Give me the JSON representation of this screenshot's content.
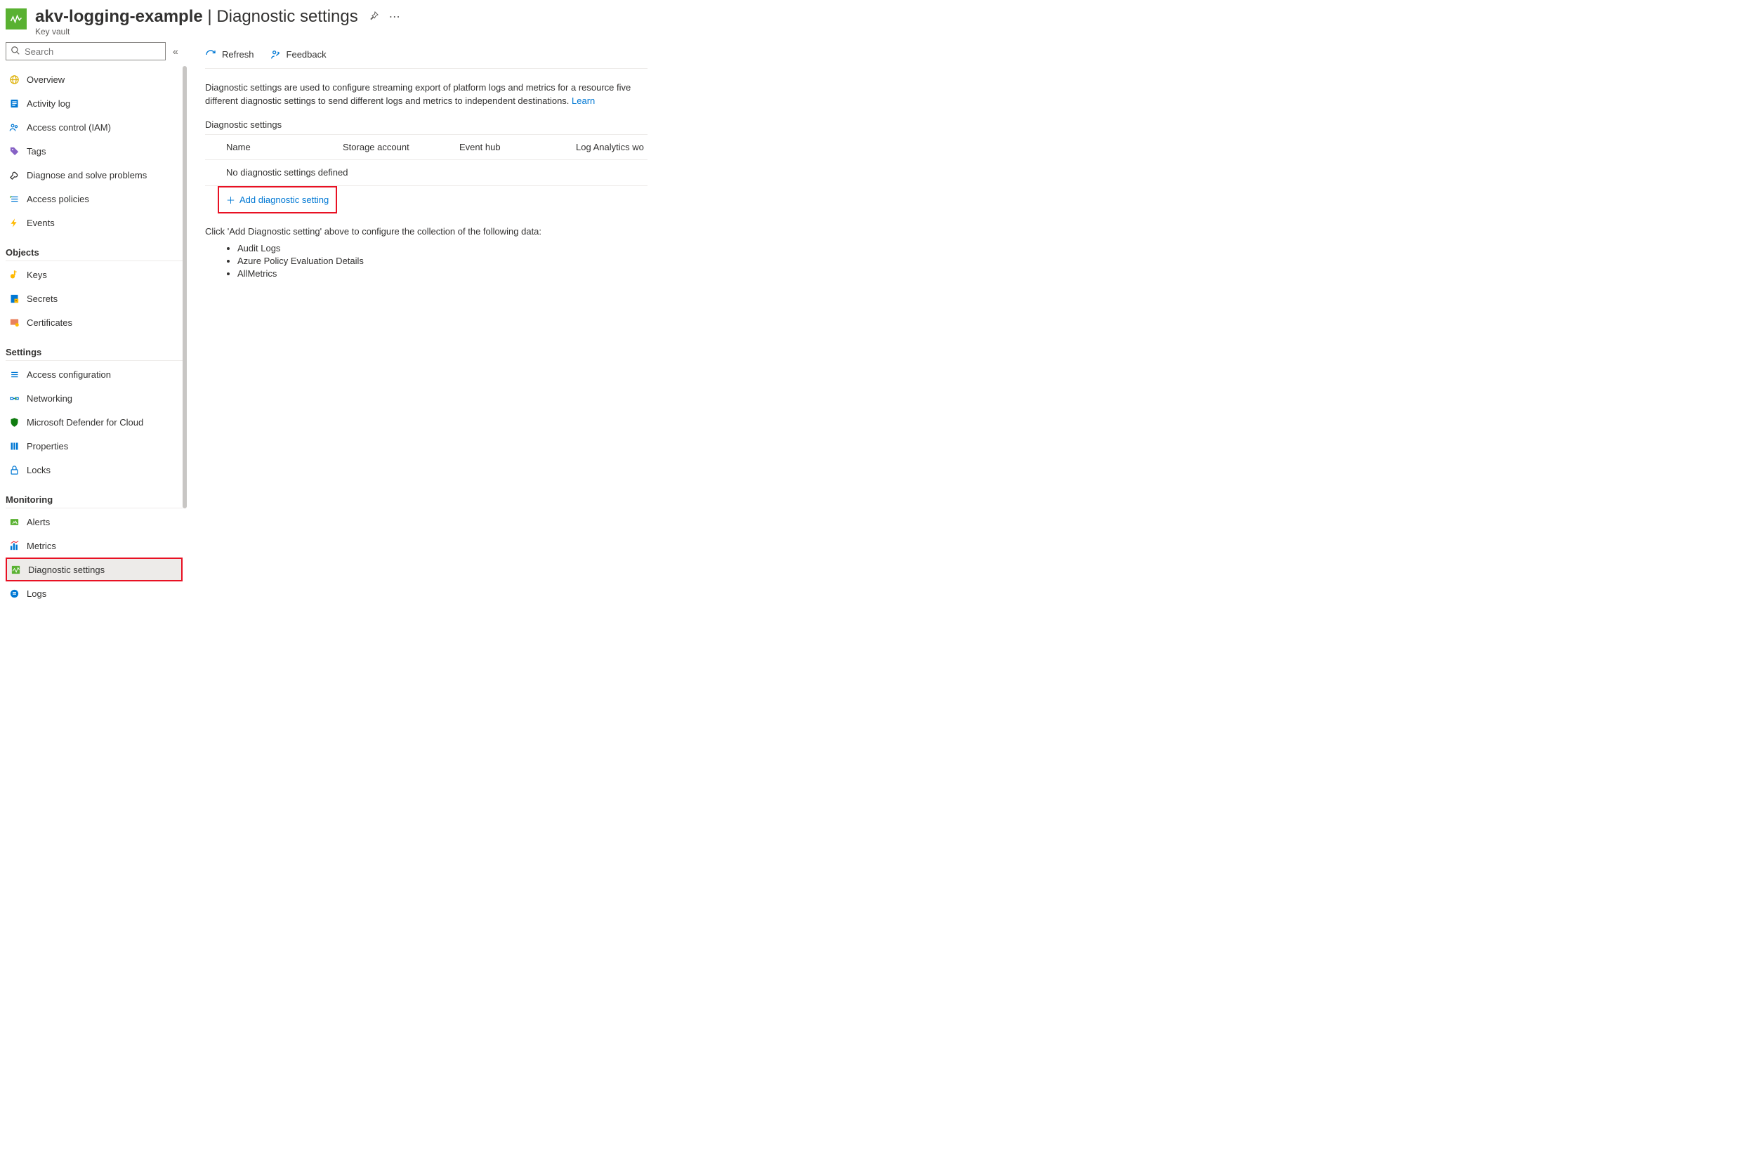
{
  "header": {
    "resource_name": "akv-logging-example",
    "page_title": "Diagnostic settings",
    "resource_type": "Key vault"
  },
  "sidebar": {
    "search_placeholder": "Search",
    "items_top": [
      {
        "label": "Overview"
      },
      {
        "label": "Activity log"
      },
      {
        "label": "Access control (IAM)"
      },
      {
        "label": "Tags"
      },
      {
        "label": "Diagnose and solve problems"
      },
      {
        "label": "Access policies"
      },
      {
        "label": "Events"
      }
    ],
    "group_objects": "Objects",
    "items_objects": [
      {
        "label": "Keys"
      },
      {
        "label": "Secrets"
      },
      {
        "label": "Certificates"
      }
    ],
    "group_settings": "Settings",
    "items_settings": [
      {
        "label": "Access configuration"
      },
      {
        "label": "Networking"
      },
      {
        "label": "Microsoft Defender for Cloud"
      },
      {
        "label": "Properties"
      },
      {
        "label": "Locks"
      }
    ],
    "group_monitoring": "Monitoring",
    "items_monitoring": [
      {
        "label": "Alerts"
      },
      {
        "label": "Metrics"
      },
      {
        "label": "Diagnostic settings"
      },
      {
        "label": "Logs"
      }
    ]
  },
  "toolbar": {
    "refresh": "Refresh",
    "feedback": "Feedback"
  },
  "content": {
    "description_prefix": "Diagnostic settings are used to configure streaming export of platform logs and metrics for a resource",
    "description_suffix": " five different diagnostic settings to send different logs and metrics to independent destinations. ",
    "learn_more": "Learn ",
    "section_label": "Diagnostic settings",
    "table": {
      "col_name": "Name",
      "col_storage": "Storage account",
      "col_event": "Event hub",
      "col_la": "Log Analytics wo",
      "empty_text": "No diagnostic settings defined"
    },
    "add_button": "Add diagnostic setting",
    "instruction": "Click 'Add Diagnostic setting' above to configure the collection of the following data:",
    "data_types": [
      "Audit Logs",
      "Azure Policy Evaluation Details",
      "AllMetrics"
    ]
  }
}
